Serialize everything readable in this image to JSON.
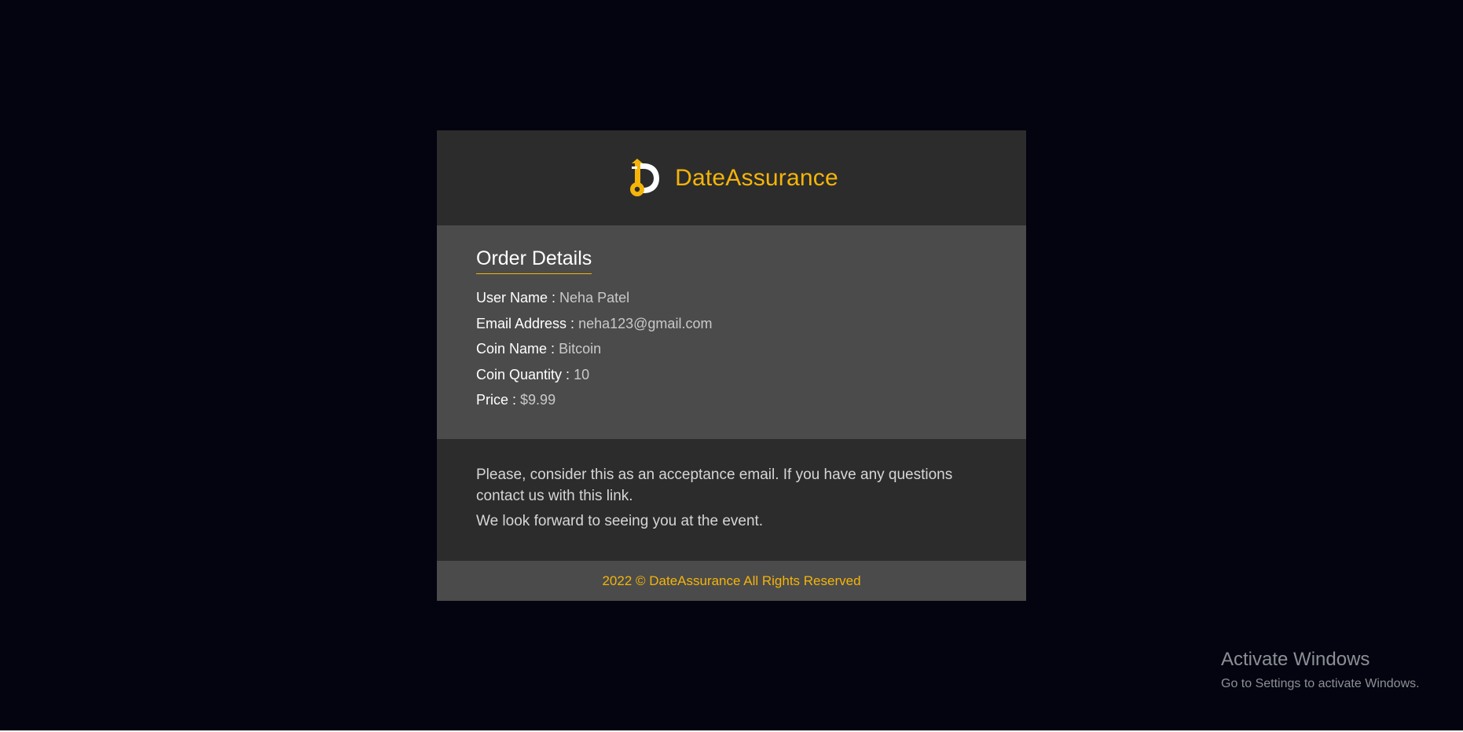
{
  "brand": {
    "name": "DateAssurance",
    "logo_icon": "d-key-logo-icon",
    "accent_color": "#f4b40a"
  },
  "order": {
    "title": "Order Details",
    "rows": [
      {
        "label": "User Name :",
        "value": "Neha Patel"
      },
      {
        "label": "Email Address :",
        "value": "neha123@gmail.com"
      },
      {
        "label": "Coin Name :",
        "value": "Bitcoin"
      },
      {
        "label": "Coin Quantity :",
        "value": "10"
      },
      {
        "label": "Price :",
        "value": "$9.99"
      }
    ]
  },
  "message": {
    "line1": "Please, consider this as an acceptance email. If you have any questions contact us with this link.",
    "line2": "We look forward to seeing you at the event."
  },
  "footer": {
    "copyright": "2022 © DateAssurance All Rights Reserved"
  },
  "watermark": {
    "title": "Activate Windows",
    "subtitle": "Go to Settings to activate Windows."
  },
  "colors": {
    "page_background": "#03040f",
    "header_background": "#2c2c2c",
    "details_background": "#4b4b4b"
  }
}
